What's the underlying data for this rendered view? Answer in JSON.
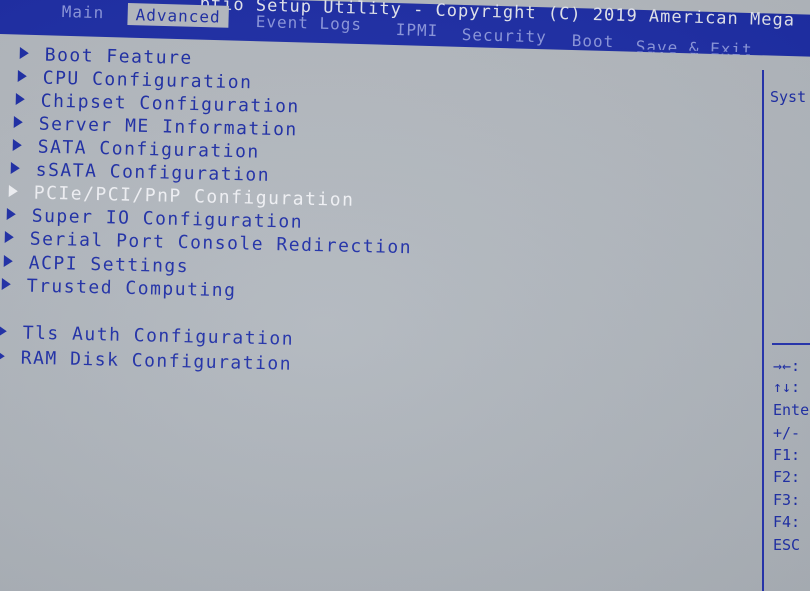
{
  "title_bar": {
    "title": "ptio Setup Utility - Copyright (C) 2019 American Mega"
  },
  "tabs": [
    {
      "label": "Main",
      "active": false
    },
    {
      "label": "Advanced",
      "active": true
    },
    {
      "label": "Event Logs",
      "active": false
    },
    {
      "label": "IPMI",
      "active": false
    },
    {
      "label": "Security",
      "active": false
    },
    {
      "label": "Boot",
      "active": false
    },
    {
      "label": "Save & Exit",
      "active": false
    }
  ],
  "menu": {
    "items": [
      {
        "label": "Boot Feature",
        "highlighted": false
      },
      {
        "label": "CPU Configuration",
        "highlighted": false
      },
      {
        "label": "Chipset Configuration",
        "highlighted": false
      },
      {
        "label": "Server ME Information",
        "highlighted": false
      },
      {
        "label": "SATA Configuration",
        "highlighted": false
      },
      {
        "label": "sSATA Configuration",
        "highlighted": false
      },
      {
        "label": "PCIe/PCI/PnP Configuration",
        "highlighted": true
      },
      {
        "label": "Super IO Configuration",
        "highlighted": false
      },
      {
        "label": "Serial Port Console Redirection",
        "highlighted": false
      },
      {
        "label": "ACPI Settings",
        "highlighted": false
      },
      {
        "label": "Trusted Computing",
        "highlighted": false
      },
      {
        "label": "Tls Auth Configuration",
        "highlighted": false
      },
      {
        "label": "RAM Disk Configuration",
        "highlighted": false
      }
    ]
  },
  "help_panel": {
    "title": "Syst",
    "keys": [
      "→←:",
      "↑↓:",
      "Ente",
      "+/-",
      "F1:",
      "F2:",
      "F3:",
      "F4:",
      "ESC"
    ]
  },
  "colors": {
    "accent": "#1f2fa8",
    "background": "#b4b9c0",
    "highlight_text": "#f2f3f7"
  }
}
